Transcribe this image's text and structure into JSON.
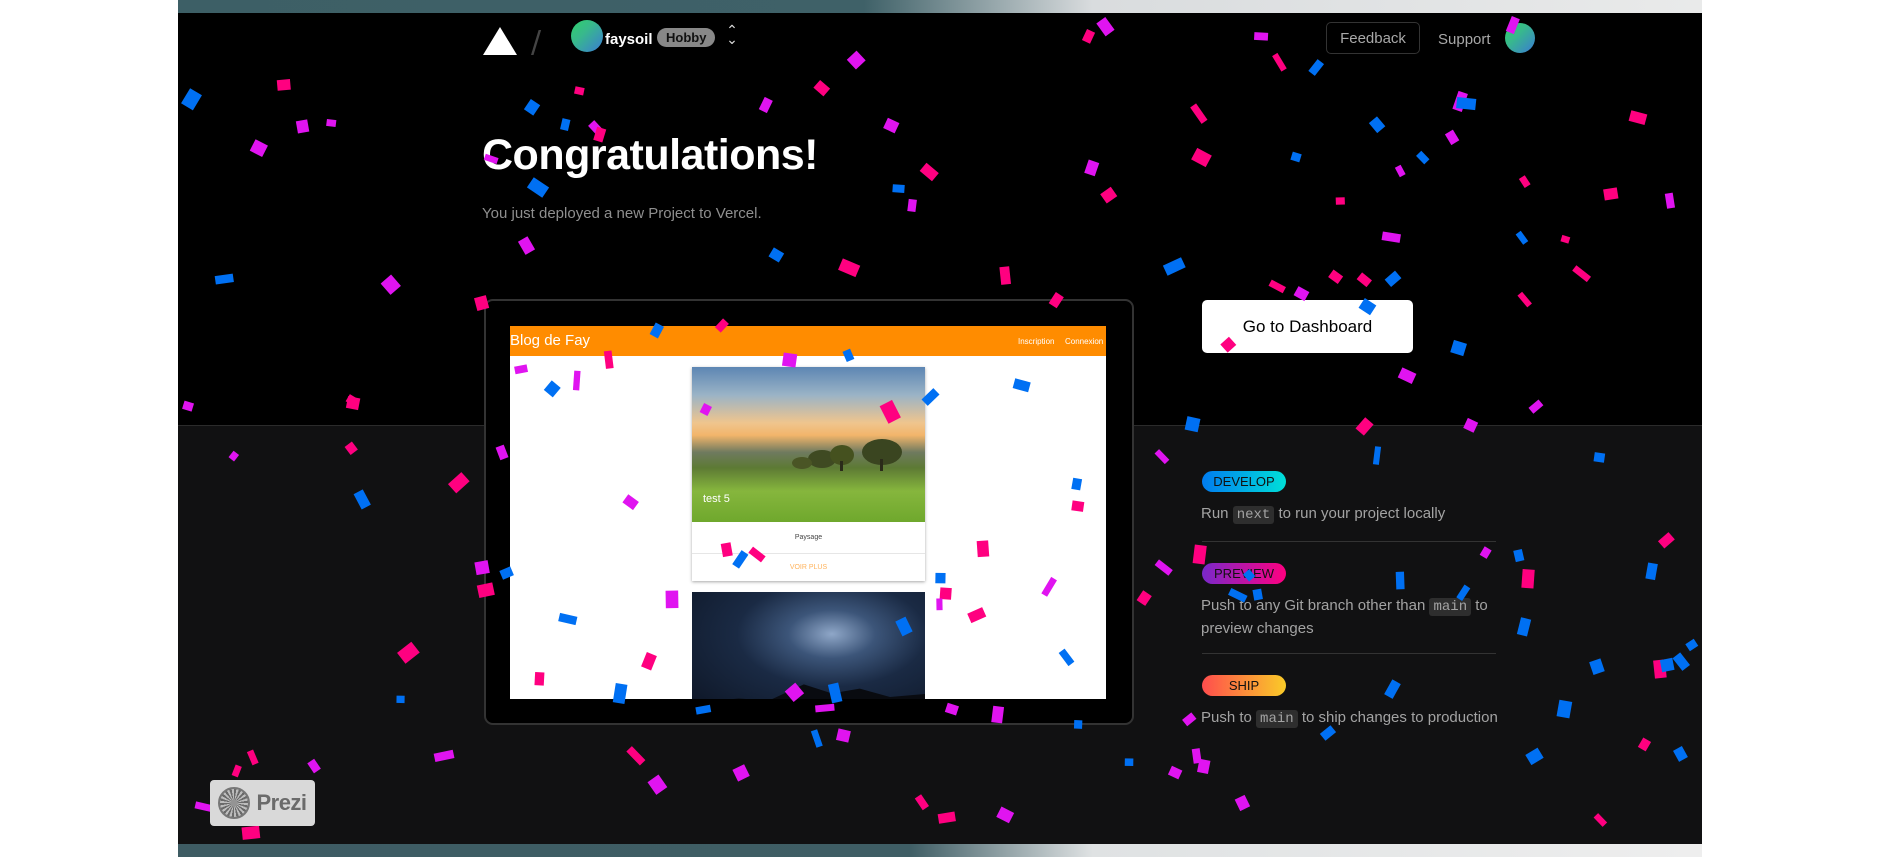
{
  "nav": {
    "team_name": "faysoil",
    "plan_badge": "Hobby",
    "feedback_label": "Feedback",
    "support_label": "Support",
    "avatar_gradient": [
      "#2fd06a",
      "#3a7bd5"
    ]
  },
  "hero": {
    "title": "Congratulations!",
    "subtitle": "You just deployed a new Project to Vercel."
  },
  "preview": {
    "blog_title": "Blog de Fay",
    "links": [
      "Inscription",
      "Connexion"
    ],
    "card": {
      "title": "test 5",
      "text": "Paysage",
      "action": "VOIR PLUS"
    },
    "accent": "#ff8c00"
  },
  "actions": {
    "dashboard_label": "Go to Dashboard"
  },
  "steps": [
    {
      "badge": "DEVELOP",
      "pre": "Run ",
      "code": "next",
      "post": " to run your project locally"
    },
    {
      "badge": "PREVIEW",
      "pre": "Push to any Git branch other than ",
      "code": "main",
      "post": " to preview changes"
    },
    {
      "badge": "SHIP",
      "pre": "Push to ",
      "code": "main",
      "post": " to ship changes to production"
    }
  ],
  "overlay": {
    "prezi_label": "Prezi"
  },
  "confetti_colors": [
    "#0070f3",
    "#ff0080",
    "#e014f0"
  ]
}
